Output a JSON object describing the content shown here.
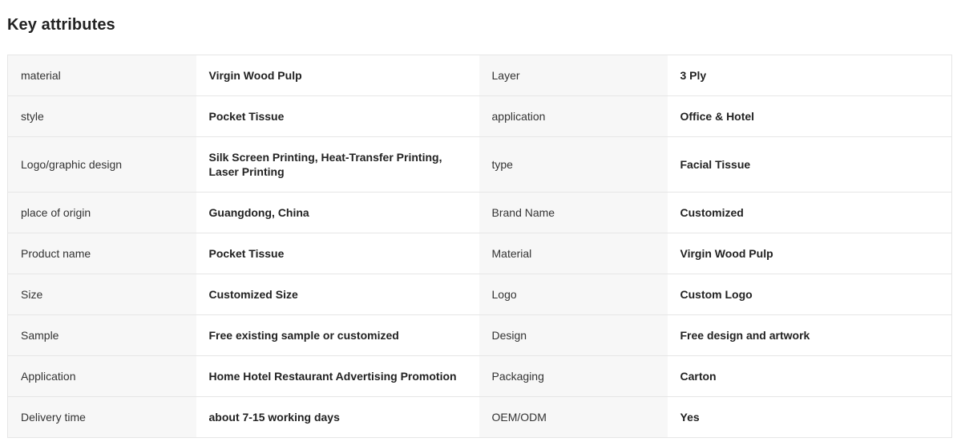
{
  "section": {
    "title": "Key attributes"
  },
  "attributes": {
    "rows": [
      {
        "label1": "material",
        "value1": "Virgin Wood Pulp",
        "label2": "Layer",
        "value2": "3 Ply"
      },
      {
        "label1": "style",
        "value1": "Pocket Tissue",
        "label2": "application",
        "value2": "Office & Hotel"
      },
      {
        "label1": "Logo/graphic design",
        "value1": "Silk Screen Printing, Heat-Transfer Printing, Laser Printing",
        "label2": "type",
        "value2": "Facial Tissue"
      },
      {
        "label1": "place of origin",
        "value1": "Guangdong, China",
        "label2": "Brand Name",
        "value2": "Customized"
      },
      {
        "label1": "Product name",
        "value1": "Pocket Tissue",
        "label2": "Material",
        "value2": "Virgin Wood Pulp"
      },
      {
        "label1": "Size",
        "value1": "Customized Size",
        "label2": "Logo",
        "value2": "Custom Logo"
      },
      {
        "label1": "Sample",
        "value1": "Free existing sample or customized",
        "label2": "Design",
        "value2": "Free design and artwork"
      },
      {
        "label1": "Application",
        "value1": "Home Hotel Restaurant Advertising Promotion",
        "label2": "Packaging",
        "value2": "Carton"
      },
      {
        "label1": "Delivery time",
        "value1": "about 7-15 working days",
        "label2": "OEM/ODM",
        "value2": "Yes"
      }
    ]
  }
}
